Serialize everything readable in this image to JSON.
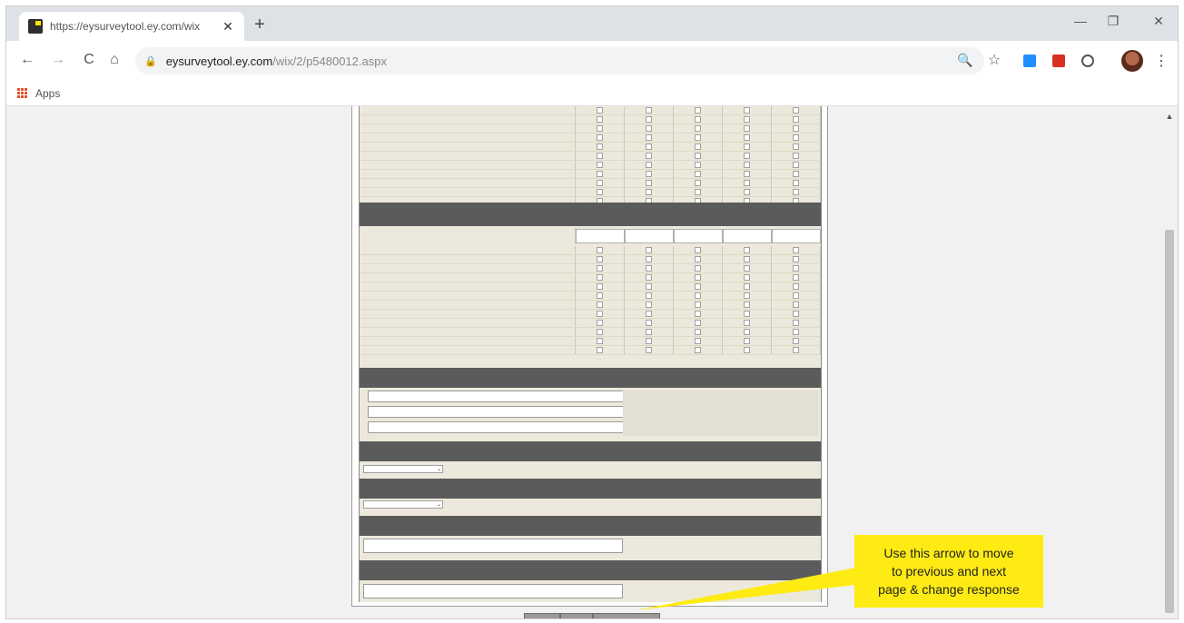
{
  "browser": {
    "tab": {
      "title": "https://eysurveytool.ey.com/wix",
      "close": "✕"
    },
    "new_tab": "+",
    "window_controls": {
      "minimize": "—",
      "restore": "❐",
      "close": "✕"
    },
    "nav": {
      "back": "←",
      "forward": "→",
      "reload": "C",
      "home": "⌂"
    },
    "address": {
      "lock": "🔒",
      "host": "eysurveytool.ey.com",
      "path": "/wix/2/p5480012.aspx"
    },
    "omnibox_icons": {
      "zoom": "🔍",
      "star": "☆"
    },
    "menu": "⋮",
    "bookmarks": {
      "apps_label": "Apps"
    }
  },
  "survey": {
    "grid1_rows": 11,
    "grid2_rows": 12,
    "columns": 5,
    "text_inputs_q3": 3,
    "pager_buttons": 3
  },
  "colors": {
    "header": "#5b5b5b",
    "panel": "#ece9dc",
    "callout": "#ffeb14"
  },
  "callout": {
    "line1": "Use this arrow to move",
    "line2": "to previous and next",
    "line3": "page & change response"
  },
  "scrollbar": {
    "up_arrow": "▲"
  }
}
